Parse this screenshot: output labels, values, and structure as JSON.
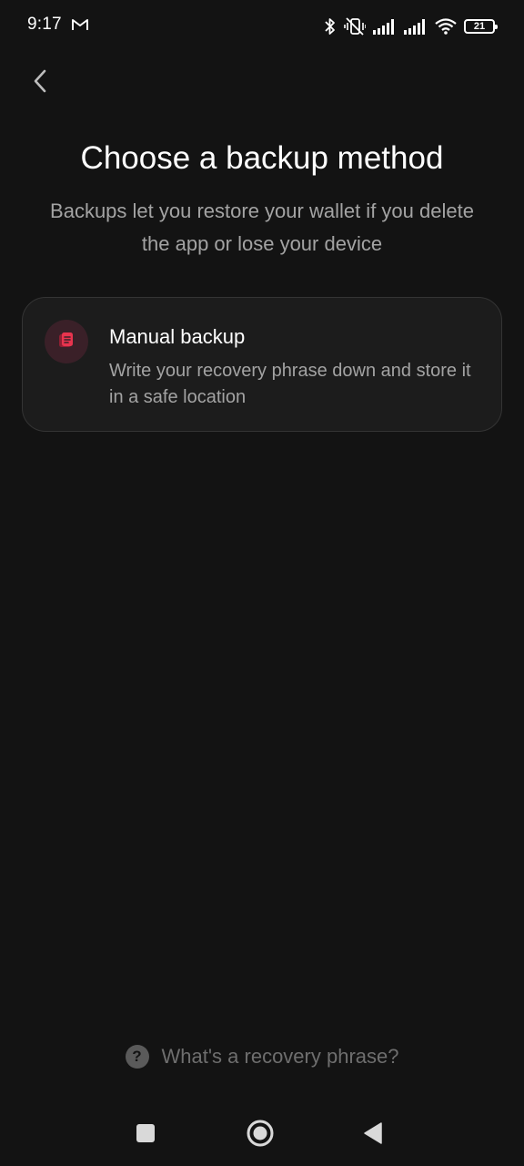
{
  "status_bar": {
    "time": "9:17",
    "battery": "21",
    "icons": [
      "gmail-icon",
      "bluetooth-icon",
      "vibrate-off-icon",
      "signal-icon",
      "signal-icon",
      "wifi-icon",
      "battery-icon"
    ]
  },
  "header": {
    "back_icon": "chevron-left-icon"
  },
  "main": {
    "title": "Choose a backup method",
    "subtitle": "Backups let you restore your wallet if you delete the app or lose your device",
    "options": [
      {
        "icon": "document-icon",
        "title": "Manual backup",
        "description": "Write your recovery phrase down and store it in a safe location"
      }
    ]
  },
  "footer": {
    "help_icon": "question-icon",
    "help_text": "What's a recovery phrase?"
  },
  "nav": {
    "recents_icon": "square-icon",
    "home_icon": "circle-icon",
    "back_icon": "triangle-back-icon"
  },
  "colors": {
    "background": "#131313",
    "card": "#1c1c1c",
    "accent": "#e8344e",
    "muted_text": "#a3a3a3"
  }
}
